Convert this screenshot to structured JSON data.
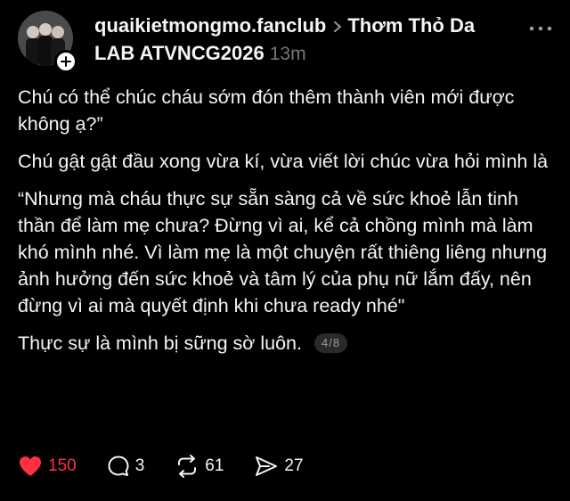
{
  "header": {
    "username": "quaikietmongmo.fanclub",
    "community": "Thơm Thỏ Da LAB ATVNCG2026",
    "time": "13m"
  },
  "post": {
    "paragraphs": [
      "Chú có thể chúc cháu sớm đón thêm thành viên mới được không ạ?”",
      "Chú gật gật đầu xong vừa kí, vừa viết lời chúc vừa hỏi mình là",
      "“Nhưng mà cháu thực sự sẵn sàng cả về sức khoẻ lẫn tinh thần để làm mẹ chưa? Đừng vì ai, kể cả chồng mình mà làm khó mình nhé. Vì làm mẹ là một chuyện rất thiêng liêng nhưng ảnh hưởng đến sức khoẻ và tâm lý của phụ nữ lắm đấy, nên đừng vì ai mà quyết định khi chưa ready nhé\""
    ],
    "last_paragraph": "Thực sự là mình bị sững sờ luôn.",
    "page_indicator": "4/8"
  },
  "actions": {
    "likes": "150",
    "comments": "3",
    "reposts": "61",
    "shares": "27"
  },
  "colors": {
    "background": "#000000",
    "text": "#f3f5f7",
    "muted": "#777777",
    "like": "#ff3040"
  }
}
